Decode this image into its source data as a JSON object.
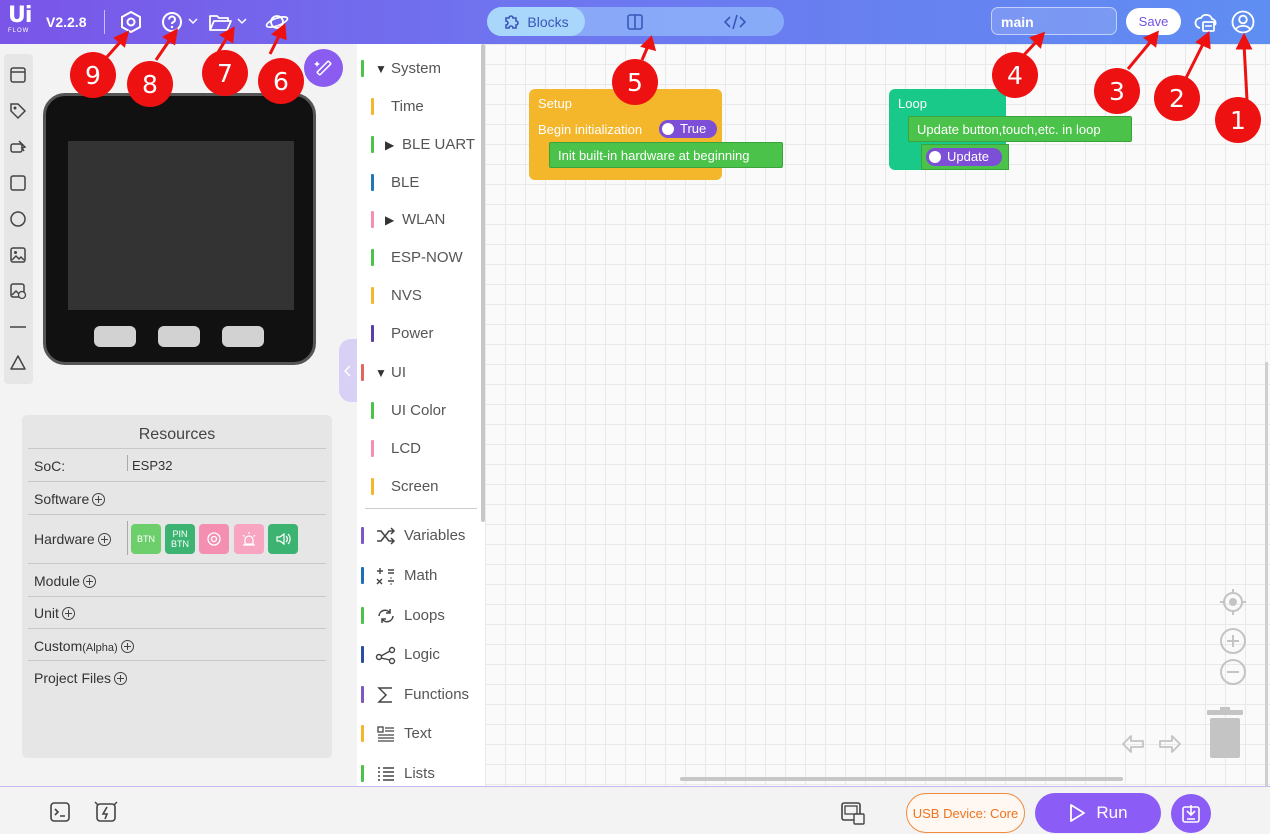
{
  "app": {
    "logo_text": "UiFlow",
    "version": "V2.2.8"
  },
  "toolbar": {
    "settings_icon": "settings-hex-icon",
    "help_icon": "help-icon",
    "folder_icon": "folder-icon",
    "planet_icon": "planet-icon",
    "mode_blocks_label": "Blocks",
    "file_name": "main",
    "save_label": "Save",
    "cloud_icon": "cloud-device-icon",
    "user_icon": "user-icon"
  },
  "annotations": [
    "1",
    "2",
    "3",
    "4",
    "5",
    "6",
    "7",
    "8",
    "9"
  ],
  "annotation_color": "#ee1111",
  "resources": {
    "title": "Resources",
    "soc_label": "SoC:",
    "soc_value": "ESP32",
    "software_label": "Software",
    "hardware_label": "Hardware",
    "hardware_chips": [
      {
        "label": "BTN",
        "color": "#6ccf6c"
      },
      {
        "label": "PIN BTN",
        "color": "#3cb371"
      },
      {
        "label": "@",
        "color": "#f48fb1"
      },
      {
        "label": "light",
        "color": "#f8a5c2"
      },
      {
        "label": "speaker",
        "color": "#3cb371"
      }
    ],
    "module_label": "Module",
    "unit_label": "Unit",
    "custom_label": "Custom",
    "custom_tag": "(Alpha)",
    "project_files_label": "Project Files"
  },
  "categories": [
    {
      "label": "System",
      "color": "#4bc34b",
      "expanded": true
    },
    {
      "label": "Time",
      "color": "#f4b62b"
    },
    {
      "label": "BLE UART",
      "color": "#4bc34b",
      "collapsed": true
    },
    {
      "label": "BLE",
      "color": "#1f77b4"
    },
    {
      "label": "WLAN",
      "color": "#f48fb1",
      "collapsed": true
    },
    {
      "label": "ESP-NOW",
      "color": "#4bc34b"
    },
    {
      "label": "NVS",
      "color": "#f4b62b"
    },
    {
      "label": "Power",
      "color": "#5b3fa6"
    },
    {
      "label": "UI",
      "color": "#e06666",
      "expanded": true
    },
    {
      "label": "UI Color",
      "color": "#4bc34b"
    },
    {
      "label": "LCD",
      "color": "#f48fb1"
    },
    {
      "label": "Screen",
      "color": "#f4b62b"
    },
    {
      "label": "Variables",
      "color": "#7e57c2"
    },
    {
      "label": "Math",
      "color": "#1f6fb4"
    },
    {
      "label": "Loops",
      "color": "#4bc34b"
    },
    {
      "label": "Logic",
      "color": "#2b4ea0"
    },
    {
      "label": "Functions",
      "color": "#7e57c2"
    },
    {
      "label": "Text",
      "color": "#f4b62b"
    },
    {
      "label": "Lists",
      "color": "#4bc34b"
    }
  ],
  "workspace": {
    "setup_block": {
      "title": "Setup",
      "line": "Begin initialization",
      "toggle_label": "True",
      "child": "Init built-in hardware at beginning"
    },
    "loop_block": {
      "title": "Loop",
      "child": "Update button,touch,etc. in loop",
      "toggle_label": "Update"
    }
  },
  "bottom": {
    "usb_label": "USB Device: Core",
    "run_label": "Run"
  }
}
